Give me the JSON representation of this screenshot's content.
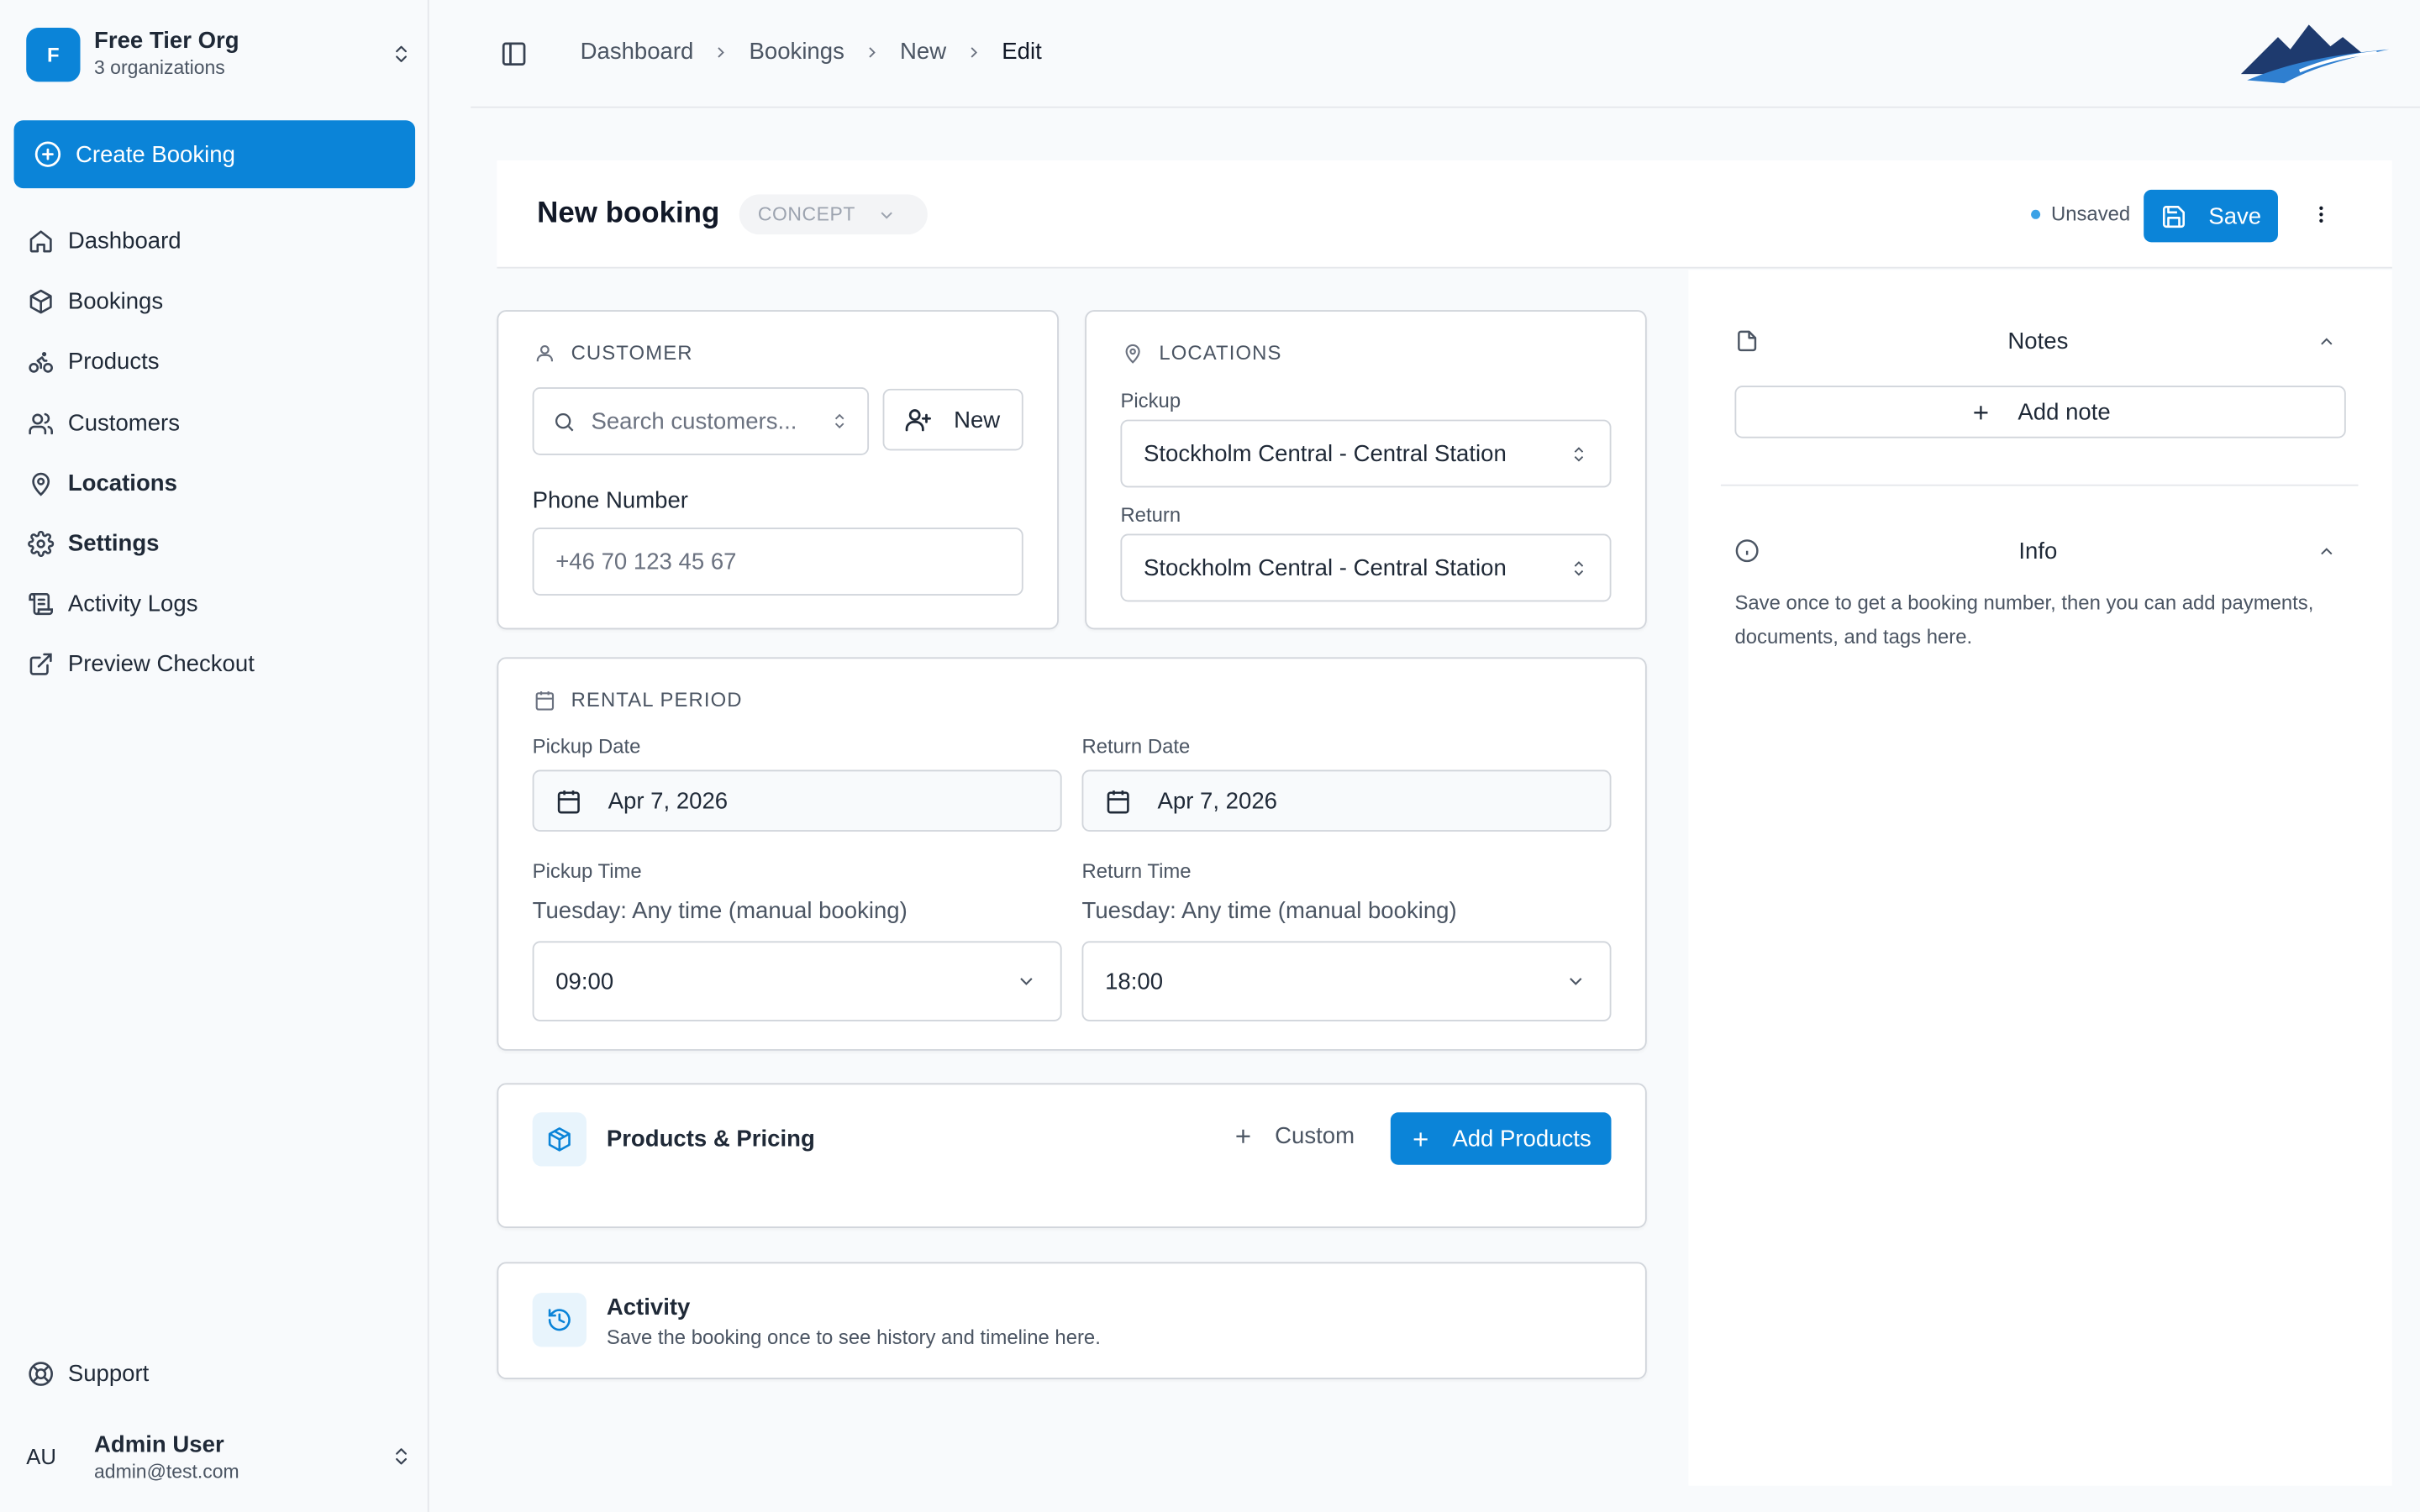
{
  "org": {
    "initial": "F",
    "name": "Free Tier Org",
    "sub": "3 organizations"
  },
  "sidebar": {
    "create_label": "Create Booking",
    "items": [
      {
        "label": "Dashboard"
      },
      {
        "label": "Bookings"
      },
      {
        "label": "Products"
      },
      {
        "label": "Customers"
      },
      {
        "label": "Locations"
      },
      {
        "label": "Settings"
      },
      {
        "label": "Activity Logs"
      },
      {
        "label": "Preview Checkout"
      }
    ],
    "support_label": "Support"
  },
  "user": {
    "initials": "AU",
    "name": "Admin User",
    "email": "admin@test.com"
  },
  "breadcrumb": [
    "Dashboard",
    "Bookings",
    "New",
    "Edit"
  ],
  "header": {
    "title": "New booking",
    "status": "CONCEPT",
    "unsaved_label": "Unsaved",
    "save_label": "Save"
  },
  "customer": {
    "heading": "CUSTOMER",
    "search_placeholder": "Search customers...",
    "new_label": "New",
    "phone_label": "Phone Number",
    "phone_placeholder": "+46 70 123 45 67"
  },
  "locations": {
    "heading": "LOCATIONS",
    "pickup_label": "Pickup",
    "pickup_value": "Stockholm Central - Central Station",
    "return_label": "Return",
    "return_value": "Stockholm Central - Central Station"
  },
  "rental": {
    "heading": "RENTAL PERIOD",
    "pickup_date_label": "Pickup Date",
    "pickup_date": "Apr 7, 2026",
    "return_date_label": "Return Date",
    "return_date": "Apr 7, 2026",
    "pickup_time_label": "Pickup Time",
    "pickup_time_note": "Tuesday: Any time (manual booking)",
    "pickup_time": "09:00",
    "return_time_label": "Return Time",
    "return_time_note": "Tuesday: Any time (manual booking)",
    "return_time": "18:00"
  },
  "products": {
    "title": "Products & Pricing",
    "custom_label": "Custom",
    "add_label": "Add Products"
  },
  "activity": {
    "title": "Activity",
    "subtitle": "Save the booking once to see history and timeline here."
  },
  "notes": {
    "title": "Notes",
    "add_label": "Add note"
  },
  "info": {
    "title": "Info",
    "text": "Save once to get a booking number, then you can add payments, documents, and tags here."
  },
  "colors": {
    "accent": "#0b84d8",
    "background": "#f8fafc"
  }
}
